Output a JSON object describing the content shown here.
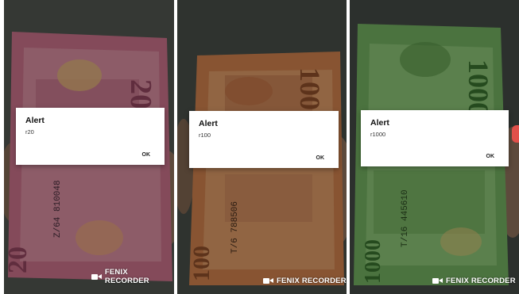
{
  "panels": [
    {
      "dialog": {
        "title": "Alert",
        "message": "r20",
        "ok_label": "OK"
      },
      "watermark": "FENIX RECORDER"
    },
    {
      "dialog": {
        "title": "Alert",
        "message": "r100",
        "ok_label": "OK"
      },
      "watermark": "FENIX RECORDER"
    },
    {
      "dialog": {
        "title": "Alert",
        "message": "r1000",
        "ok_label": "OK"
      },
      "watermark": "FENIX RECORDER"
    }
  ],
  "banknotes": [
    {
      "denomination_text": "20",
      "serial": "Z/64 810048"
    },
    {
      "denomination_text": "100",
      "serial": "T/6 788506"
    },
    {
      "denomination_text": "1000",
      "serial": "T/16 445610"
    }
  ],
  "colors": {
    "note_20": "#c2637a",
    "note_100": "#c8703a",
    "note_1000": "#6ea85a",
    "accent_red": "#e0504a"
  }
}
